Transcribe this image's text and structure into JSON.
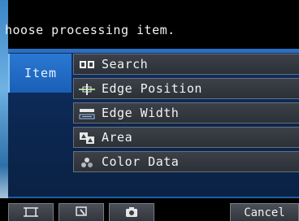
{
  "header": {
    "title": "hoose processing item."
  },
  "tab": {
    "label": "Item"
  },
  "menu": {
    "items": [
      {
        "label": "Search",
        "icon": "search-pattern-icon"
      },
      {
        "label": "Edge Position",
        "icon": "edge-position-icon"
      },
      {
        "label": "Edge Width",
        "icon": "edge-width-icon"
      },
      {
        "label": "Area",
        "icon": "area-icon"
      },
      {
        "label": "Color Data",
        "icon": "color-data-icon"
      }
    ]
  },
  "toolbar": {
    "cancel_label": "Cancel",
    "icons": [
      "frame-icon",
      "zoom-icon",
      "camera-icon"
    ]
  },
  "colors": {
    "accent": "#2a6fc0",
    "panel": "#0b264f",
    "item_bg": "#34383f"
  }
}
